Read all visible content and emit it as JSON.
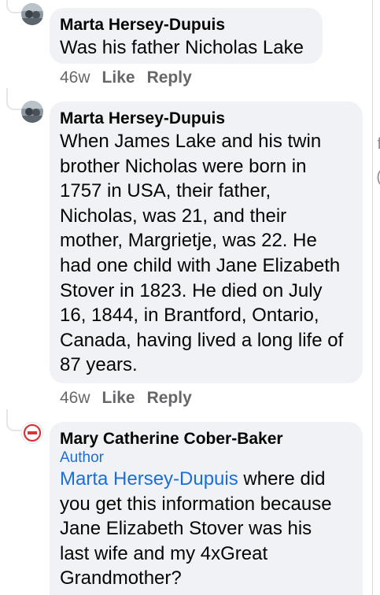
{
  "comments": [
    {
      "author": "Marta Hersey-Dupuis",
      "text": "Was his father Nicholas Lake",
      "time": "46w",
      "like_label": "Like",
      "reply_label": "Reply"
    },
    {
      "author": "Marta Hersey-Dupuis",
      "lines": [
        "When James Lake and his twin",
        "brother Nicholas were born in",
        "1757 in USA, their father,",
        "Nicholas, was 21, and their",
        "mother, Margrietje, was 22. He",
        "had one child with Jane Elizabeth",
        "Stover in 1823. He died on July",
        "16, 1844, in Brantford, Ontario,",
        "Canada, having lived a long life of",
        "87 years."
      ],
      "time": "46w",
      "like_label": "Like",
      "reply_label": "Reply"
    },
    {
      "author": "Mary Catherine Cober-Baker",
      "badge": "Author",
      "mention": "Marta Hersey-Dupuis",
      "lines": [
        " where did",
        "you get this information because",
        "Jane Elizabeth Stover was his",
        "last wife and my 4xGreat",
        "Grandmother?"
      ]
    }
  ],
  "edge_glyphs": [
    "f",
    "("
  ]
}
